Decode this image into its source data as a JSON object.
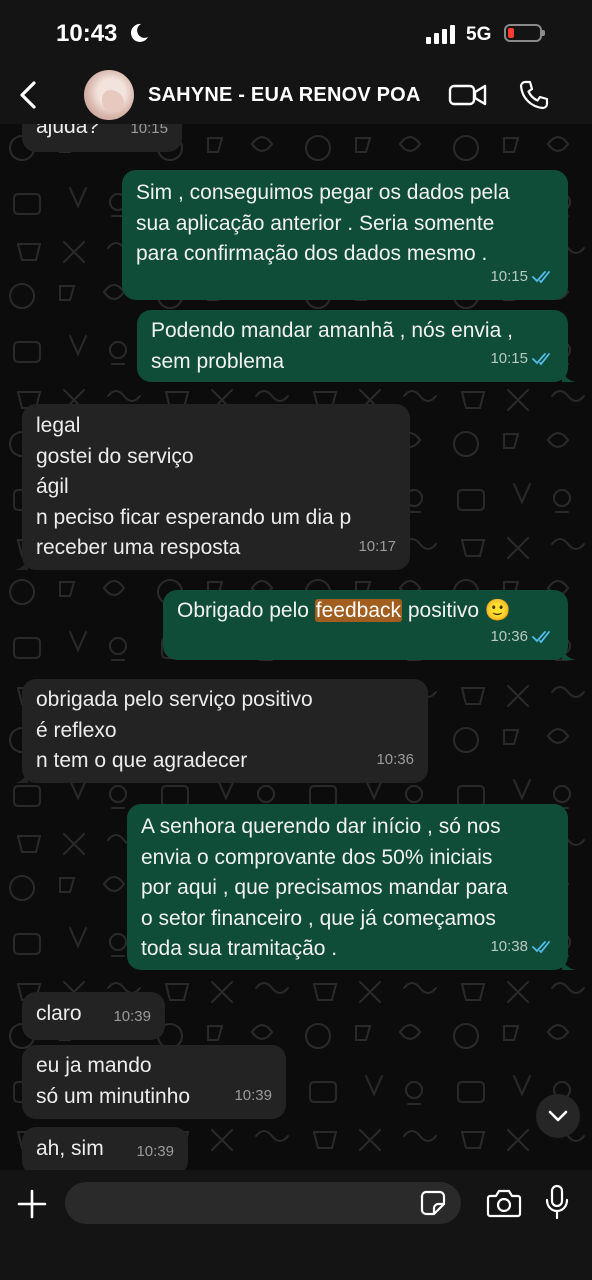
{
  "status_bar": {
    "time": "10:43",
    "network": "5G",
    "battery_level": 0.2
  },
  "header": {
    "contact_name": "SAHYNE - EUA RENOV POA"
  },
  "messages": [
    {
      "dir": "in",
      "text": "ajuda?",
      "time": "10:15"
    },
    {
      "dir": "out",
      "text": "Sim , conseguimos pegar os dados pela\nsua aplicação anterior . Seria somente\npara confirmação dos dados mesmo .",
      "time": "10:15",
      "read": true
    },
    {
      "dir": "out",
      "text": "Podendo mandar amanhã , nós envia ,\nsem problema",
      "time": "10:15",
      "read": true
    },
    {
      "dir": "in",
      "text": "legal\ngostei do serviço\nágil\nn peciso ficar esperando um dia p\nreceber uma resposta",
      "time": "10:17"
    },
    {
      "dir": "out",
      "text_before": "Obrigado pelo ",
      "text_highlight": "feedback",
      "text_after": " positivo",
      "emoji": "🙂",
      "time": "10:36",
      "read": true
    },
    {
      "dir": "in",
      "text": "obrigada pelo serviço positivo\né reflexo\nn tem o que agradecer",
      "time": "10:36"
    },
    {
      "dir": "out",
      "text": "A senhora querendo dar início , só nos\nenvia o comprovante dos 50% iniciais\npor aqui , que precisamos mandar para\no setor financeiro , que já começamos\ntoda sua tramitação .",
      "time": "10:38",
      "read": true
    },
    {
      "dir": "in",
      "text": "claro",
      "time": "10:39"
    },
    {
      "dir": "in",
      "text": "eu ja mando\nsó um minutinho",
      "time": "10:39"
    },
    {
      "dir": "in",
      "text": "ah, sim",
      "time": "10:39"
    }
  ],
  "input": {
    "placeholder": ""
  },
  "icons": {
    "back": "chevron-left-icon",
    "video": "video-camera-icon",
    "call": "phone-icon",
    "plus": "plus-icon",
    "sticker": "sticker-icon",
    "camera": "camera-icon",
    "mic": "microphone-icon",
    "scroll": "chevron-down-icon",
    "read": "double-check-icon"
  },
  "colors": {
    "incoming_bubble": "#232323",
    "outgoing_bubble": "#0f4d38",
    "read_ticks": "#53bdeb",
    "highlight": "#a25e1e"
  }
}
